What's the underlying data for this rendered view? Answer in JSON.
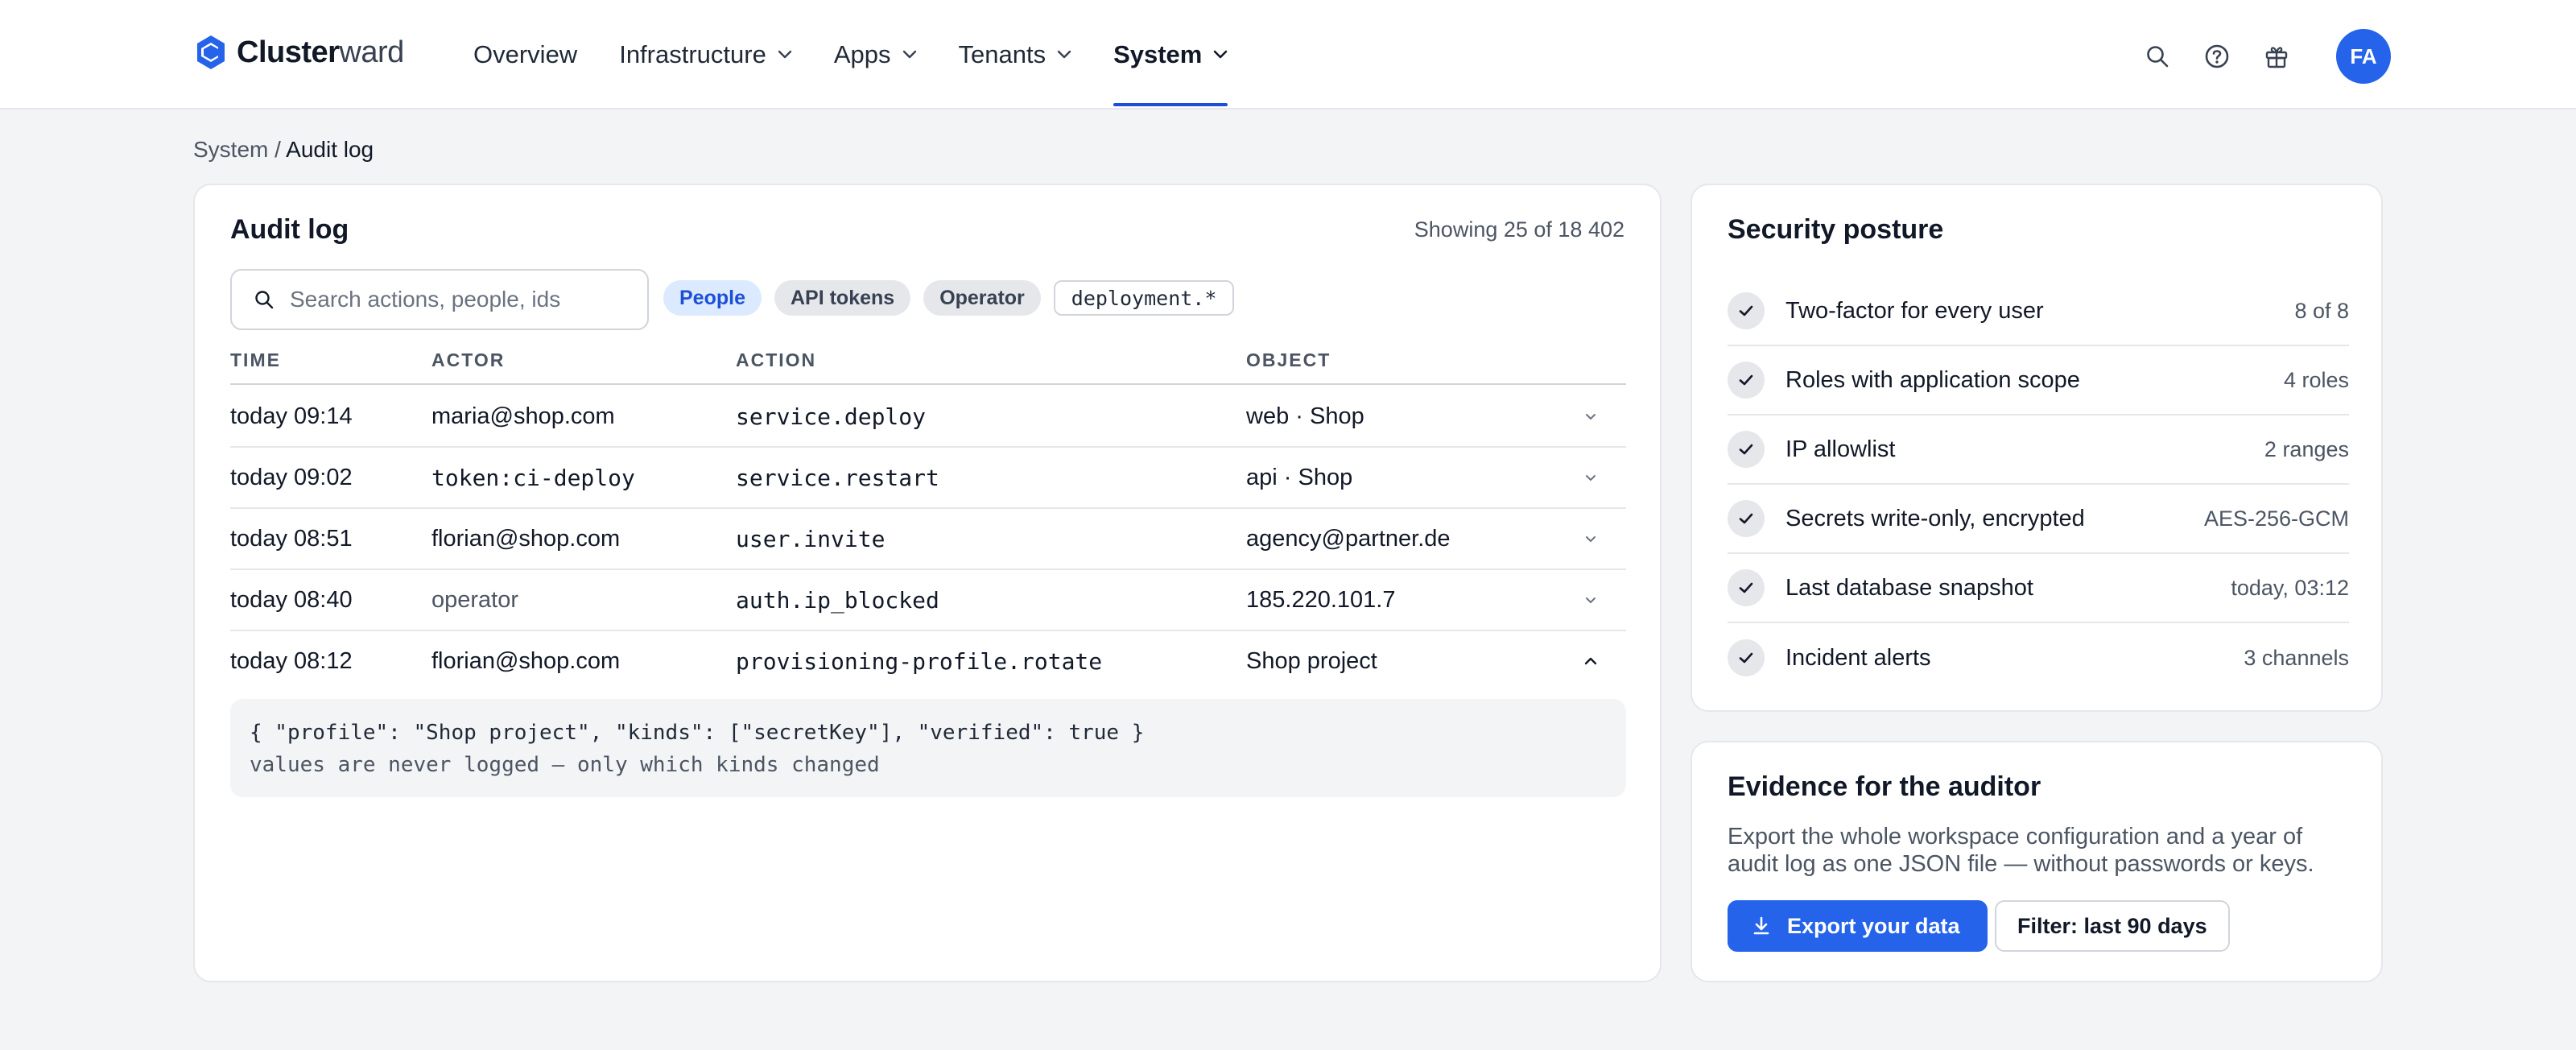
{
  "brand": {
    "name_bold": "Cluster",
    "name_light": "ward",
    "accent": "#2563eb"
  },
  "nav": {
    "items": [
      {
        "label": "Overview"
      },
      {
        "label": "Infrastructure"
      },
      {
        "label": "Apps"
      },
      {
        "label": "Tenants"
      },
      {
        "label": "System"
      }
    ],
    "active": "System"
  },
  "topbar": {
    "icons": [
      "search-icon",
      "help-icon",
      "gift-icon"
    ],
    "avatar_initials": "FA"
  },
  "breadcrumb": {
    "parent": "System",
    "separator": " / ",
    "current": "Audit log"
  },
  "audit": {
    "title": "Audit log",
    "showing": "Showing 25 of 18 402",
    "search_placeholder": "Search actions, people, ids",
    "filters": [
      {
        "label": "People",
        "active": true
      },
      {
        "label": "API tokens",
        "active": false
      },
      {
        "label": "Operator",
        "active": false
      },
      {
        "label": "deployment.*",
        "active": false
      }
    ],
    "columns": [
      "TIME",
      "ACTOR",
      "ACTION",
      "OBJECT"
    ],
    "rows": [
      {
        "time": "today 09:14",
        "actor": "maria@shop.com",
        "action": "service.deploy",
        "object": "web · Shop",
        "expanded": false
      },
      {
        "time": "today 09:02",
        "actor": "token:ci-deploy",
        "action": "service.restart",
        "object": "api · Shop",
        "expanded": false
      },
      {
        "time": "today 08:51",
        "actor": "florian@shop.com",
        "action": "user.invite",
        "object": "agency@partner.de",
        "expanded": false
      },
      {
        "time": "today 08:40",
        "actor": "operator",
        "action": "auth.ip_blocked",
        "object": "185.220.101.7",
        "expanded": false
      },
      {
        "time": "today 08:12",
        "actor": "florian@shop.com",
        "action": "provisioning-profile.rotate",
        "object": "Shop project",
        "expanded": true
      }
    ],
    "detail": {
      "json": "{ \"profile\": \"Shop project\", \"kinds\": [\"secretKey\"], \"verified\": true }",
      "note": "values are never logged — only which kinds changed"
    }
  },
  "security": {
    "title": "Security posture",
    "items": [
      {
        "label": "Two-factor for every user",
        "value": "8 of 8"
      },
      {
        "label": "Roles with application scope",
        "value": "4 roles"
      },
      {
        "label": "IP allowlist",
        "value": "2 ranges"
      },
      {
        "label": "Secrets write-only, encrypted",
        "value": "AES-256-GCM"
      },
      {
        "label": "Last database snapshot",
        "value": "today, 03:12"
      },
      {
        "label": "Incident alerts",
        "value": "3 channels"
      }
    ]
  },
  "evidence": {
    "title": "Evidence for the auditor",
    "text": "Export the whole workspace configuration and a year of audit log as one JSON file — without passwords or keys.",
    "export_label": "Export your data",
    "filter_label": "Filter: last 90 days"
  }
}
